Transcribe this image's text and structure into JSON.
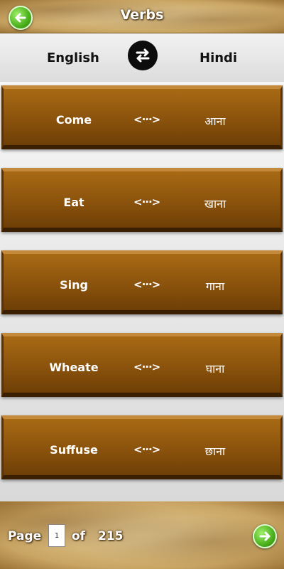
{
  "header": {
    "title": "Verbs",
    "back_icon": "arrow-left-icon"
  },
  "lang_bar": {
    "source": "English",
    "target": "Hindi",
    "swap_icon": "swap-arrows-icon"
  },
  "cards": [
    {
      "english": "Come",
      "separator": "<···>",
      "hindi": "आना"
    },
    {
      "english": "Eat",
      "separator": "<···>",
      "hindi": "खाना"
    },
    {
      "english": "Sing",
      "separator": "<···>",
      "hindi": "गाना"
    },
    {
      "english": "Wheate",
      "separator": "<···>",
      "hindi": "घाना"
    },
    {
      "english": "Suffuse",
      "separator": "<···>",
      "hindi": "छाना"
    }
  ],
  "pagination": {
    "page_label": "Page",
    "current_page": "1",
    "of_label": "of",
    "total_pages": "215",
    "next_icon": "arrow-right-icon"
  },
  "colors": {
    "card": "#8a520c",
    "accent_green": "#4bb01c",
    "header_text": "#ffffff"
  }
}
